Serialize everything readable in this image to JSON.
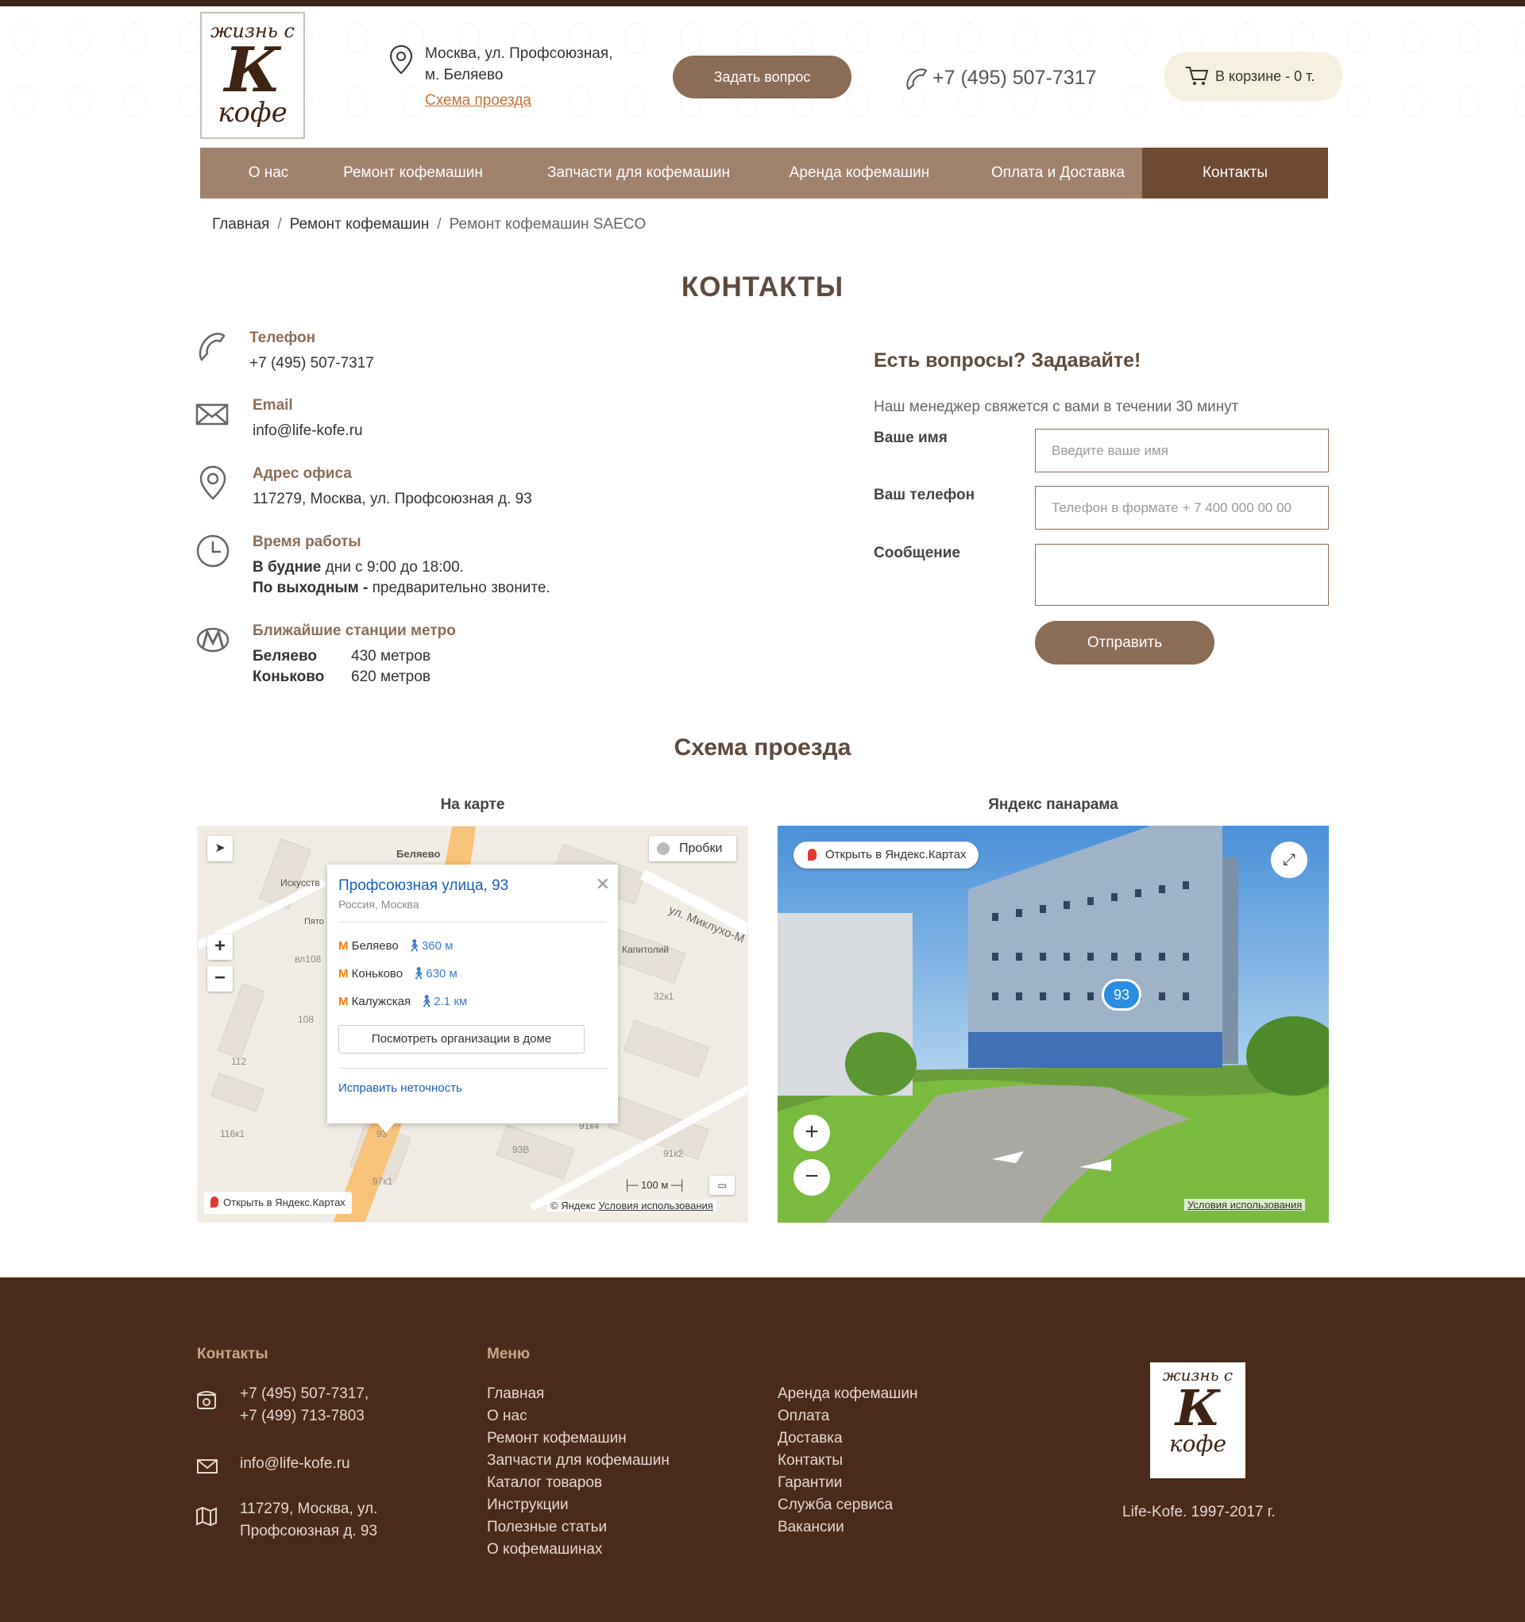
{
  "header": {
    "logo": {
      "line1": "жизнь с",
      "line2": "К",
      "line3": "кофе"
    },
    "address": {
      "line1": "Москва, ул. Профсоюзная,",
      "line2": "м. Беляево",
      "route_link": "Схема проезда"
    },
    "ask_button": "Задать вопрос",
    "phone": "+7 (495) 507-7317",
    "cart": "В корзине - 0 т."
  },
  "nav": {
    "items": [
      {
        "label": "О нас"
      },
      {
        "label": "Ремонт кофемашин"
      },
      {
        "label": "Запчасти для кофемашин"
      },
      {
        "label": "Аренда кофемашин"
      },
      {
        "label": "Оплата и Доставка"
      },
      {
        "label": "Контакты"
      }
    ]
  },
  "breadcrumb": {
    "items": [
      "Главная",
      "Ремонт кофемашин",
      "Ремонт кофемашин SAECO"
    ],
    "separator": "/"
  },
  "page_title": "КОНТАКТЫ",
  "contacts": {
    "phone": {
      "title": "Телефон",
      "value": "+7 (495) 507-7317"
    },
    "email": {
      "title": "Email",
      "value": "info@life-kofe.ru"
    },
    "office": {
      "title": "Адрес офиса",
      "value": "117279, Москва, ул. Профсоюзная д. 93"
    },
    "hours": {
      "title": "Время работы",
      "weekdays_bold": "В будние",
      "weekdays": " дни с 9:00 до 18:00.",
      "weekend_bold": "По выходным -",
      "weekend": " предварительно звоните."
    },
    "metro": {
      "title": "Ближайшие станции метро",
      "stations": [
        {
          "name": "Беляево",
          "dist": "430 метров"
        },
        {
          "name": "Коньково",
          "dist": "620 метров"
        }
      ]
    }
  },
  "form": {
    "heading": "Есть вопросы? Задавайте!",
    "subtitle": "Наш менеджер свяжется с вами в течении 30 минут",
    "name_label": "Ваше имя",
    "name_placeholder": "Введите ваше имя",
    "phone_label": "Ваш телефон",
    "phone_placeholder": "Телефон в формате + 7 400 000 00 00",
    "message_label": "Сообщение",
    "submit": "Отправить"
  },
  "route": {
    "heading": "Схема проезда",
    "map_title": "На карте",
    "pano_title": "Яндекс панарама",
    "map": {
      "traffic": "Пробки",
      "popup_title": "Профсоюзная улица, 93",
      "popup_sub": "Россия, Москва",
      "metro": [
        {
          "name": "Беляево",
          "dist": "360 м"
        },
        {
          "name": "Коньково",
          "dist": "630 м"
        },
        {
          "name": "Калужская",
          "dist": "2.1 км"
        }
      ],
      "orgs_button": "Посмотреть организации в доме",
      "fix_link": "Исправить неточность",
      "open_link": "Открыть в Яндекс.Картах",
      "scale": "100 м",
      "copyright": "© Яндекс",
      "terms": "Условия использования",
      "labels": [
        "Беляево",
        "Искусств",
        "ул. Миклухо-М",
        "Капитолий",
        "32к1",
        "вл108",
        "108",
        "112",
        "116к1",
        "93",
        "93В",
        "91к4",
        "91к2",
        "97к1",
        "Пято"
      ]
    },
    "pano": {
      "open_link": "Открыть в Яндекс.Картах",
      "house": "93",
      "terms": "Условия использования"
    }
  },
  "footer": {
    "contacts_title": "Контакты",
    "phones": [
      "+7 (495) 507-7317,",
      "+7 (499) 713-7803"
    ],
    "email": "info@life-kofe.ru",
    "address": [
      "117279, Москва, ул.",
      "Профсоюзная д. 93"
    ],
    "menu_title": "Меню",
    "menu_col1": [
      "Главная",
      "О нас",
      "Ремонт кофемашин",
      "Запчасти для кофемашин",
      "Каталог товаров",
      "Инструкции",
      "Полезные статьи",
      "О кофемашинах"
    ],
    "menu_col2": [
      "Аренда кофемашин",
      "Оплата",
      "Доставка",
      "Контакты",
      "Гарантии",
      "Служба сервиса",
      "Вакансии"
    ],
    "copyright": "Life-Kofe. 1997-2017 г."
  },
  "colors": {
    "brand": "#8b6c57",
    "nav": "#a0826d",
    "nav_active": "#6e4a33",
    "footer": "#4a2a1a",
    "accent_link": "#c2733a"
  }
}
